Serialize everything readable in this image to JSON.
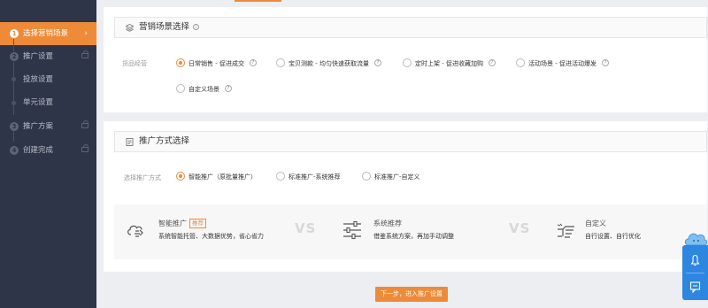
{
  "sidebar": {
    "items": [
      {
        "num": "1",
        "label": "选择营销场景"
      },
      {
        "num": "2",
        "label": "推广设置"
      },
      {
        "num": "",
        "label": "投放设置"
      },
      {
        "num": "",
        "label": "单元设置"
      },
      {
        "num": "3",
        "label": "推广方案"
      },
      {
        "num": "4",
        "label": "创建完成"
      }
    ],
    "chevron": "›"
  },
  "scene_panel": {
    "title": "营销场景选择",
    "row_label": "货品经营",
    "options": [
      {
        "label": "日常销售 - 促进成交",
        "checked": true
      },
      {
        "label": "宝贝测款 - 均匀快速获取流量",
        "checked": false
      },
      {
        "label": "定时上架 - 促进收藏加购",
        "checked": false
      },
      {
        "label": "活动场景 - 促进活动爆发",
        "checked": false
      },
      {
        "label": "自定义场景",
        "checked": false
      }
    ]
  },
  "method_panel": {
    "title": "推广方式选择",
    "row_label": "选择推广方式",
    "options": [
      {
        "label": "智能推广（原批量推广）",
        "checked": true
      },
      {
        "label": "标准推广-系统推荐",
        "checked": false
      },
      {
        "label": "标准推广-自定义",
        "checked": false
      }
    ],
    "compare": [
      {
        "title": "智能推广",
        "tag": "推荐",
        "desc": "系统智能托管、大数据优势，省心省力",
        "icon": "smart-cloud-icon"
      },
      {
        "title": "系统推荐",
        "tag": "",
        "desc": "借鉴系统方案，再加手动调整",
        "icon": "sliders-icon"
      },
      {
        "title": "自定义",
        "tag": "",
        "desc": "自行设置、自行优化",
        "icon": "hand-pointer-icon"
      }
    ],
    "vs": "VS"
  },
  "next_button": "下一步，进入推广设置",
  "help_glyph": "?",
  "colors": {
    "accent": "#ee8b38",
    "sidebar": "#2e3548",
    "float": "#2d86e0"
  }
}
